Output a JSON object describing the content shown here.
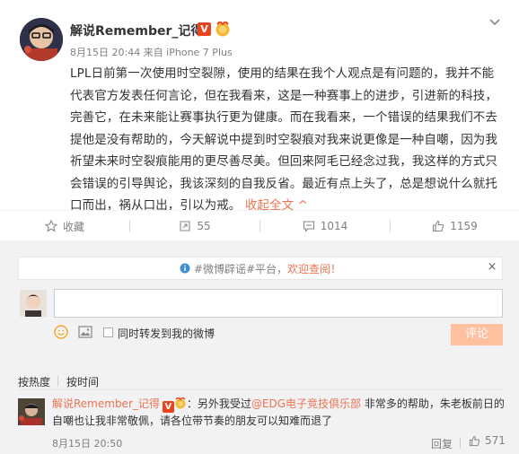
{
  "post": {
    "author": "解说Remember_记得",
    "verified_badge": "V",
    "meta": "8月15日 20:44 来自 iPhone 7 Plus",
    "text": "LPL日前第一次使用时空裂隙，使用的结果在我个人观点是有问题的，我并不能代表官方发表任何言论，但在我看来，这是一种赛事上的进步，引进新的科技，完善它，在未来能让赛事执行更为健康。而在我看来，一个错误的结果我们不去提他是没有帮助的，今天解说中提到时空裂痕对我来说更像是一种自嘲，因为我祈望未来时空裂痕能用的更尽善尽美。但回来阿毛已经念过我，我这样的方式只会错误的引导舆论，我该深刻的自我反省。最近有点上头了，总是想说什么就托口而出，祸从口出，引以为戒。",
    "collapse_label": "收起全文",
    "collapse_arrow": "^"
  },
  "actions": {
    "favorite_label": "收藏",
    "forward_count": "55",
    "comment_count": "1014",
    "like_count": "1159"
  },
  "comment_panel": {
    "notice_prefix": "#微博辟谣#平台，",
    "notice_link": "欢迎查阅！",
    "notice_close": "×",
    "forward_checkbox_label": "同时转发到我的微博",
    "submit_label": "评论",
    "sort_hot": "按热度",
    "sort_time": "按时间"
  },
  "comment": {
    "author": "解说Remember_记得",
    "verified_badge": "V",
    "text_before_link": "：另外我受过",
    "link": "@EDG电子竞技俱乐部",
    "text_after_link": " 非常多的帮助，朱老板前日的自嘲也让我非常敬佩，请各位带节奏的朋友可以知难而退了",
    "time": "8月15日 20:50",
    "reply_label": "回复",
    "like_count": "571"
  },
  "colors": {
    "accent": "#eb7350",
    "panel_bg": "#f2f2f5",
    "verified": "#e8451e",
    "submit_disabled": "#ffc09f"
  }
}
